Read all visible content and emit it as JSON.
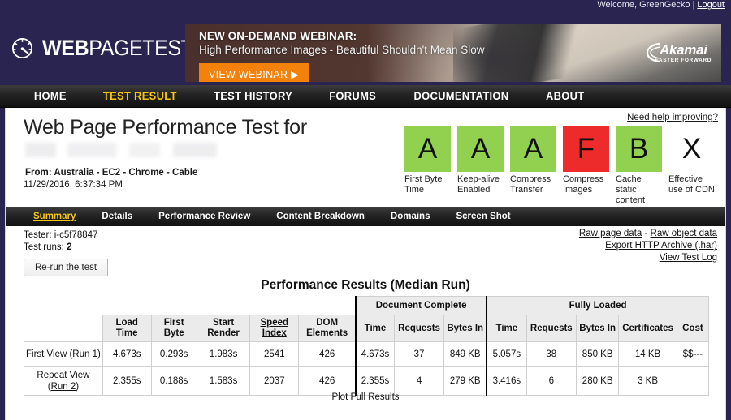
{
  "account": {
    "welcome_text": "Welcome, GreenGecko",
    "separator": "|",
    "logout_label": "Logout"
  },
  "brand": {
    "logo_bold": "WEB",
    "logo_regular": "PAGETEST",
    "logo_icon": "speedometer-icon"
  },
  "banner": {
    "headline": "NEW ON-DEMAND WEBINAR:",
    "subhead": "High Performance Images  -  Beautiful Shouldn't Mean Slow",
    "cta_label": "VIEW WEBINAR ▶",
    "sponsor_name": "Akamai",
    "sponsor_tagline": "FASTER FORWARD"
  },
  "mainnav": {
    "items": [
      {
        "label": "HOME",
        "active": false
      },
      {
        "label": "TEST RESULT",
        "active": true
      },
      {
        "label": "TEST HISTORY",
        "active": false
      },
      {
        "label": "FORUMS",
        "active": false
      },
      {
        "label": "DOCUMENTATION",
        "active": false
      },
      {
        "label": "ABOUT",
        "active": false
      }
    ]
  },
  "test": {
    "page_title": "Web Page Performance Test for",
    "url_redacted": true,
    "from_line": "From: Australia - EC2 - Chrome - Cable",
    "date_line": "11/29/2016, 6:37:34 PM",
    "tester_label": "Tester: i-c5f78847",
    "test_runs_label": "Test runs:",
    "test_runs_value": "2",
    "rerun_label": "Re-run the test"
  },
  "grades": {
    "need_help_label": "Need help improving?",
    "items": [
      {
        "grade": "A",
        "label": "First Byte Time",
        "color": "#92d050",
        "style": "green"
      },
      {
        "grade": "A",
        "label": "Keep-alive Enabled",
        "color": "#92d050",
        "style": "green"
      },
      {
        "grade": "A",
        "label": "Compress Transfer",
        "color": "#92d050",
        "style": "green"
      },
      {
        "grade": "F",
        "label": "Compress Images",
        "color": "#ee2b2b",
        "style": "red"
      },
      {
        "grade": "B",
        "label": "Cache static content",
        "color": "#92d050",
        "style": "green"
      },
      {
        "grade": "X",
        "label": "Effective use of CDN",
        "color": "#ffffff",
        "style": "none"
      }
    ]
  },
  "tabs": {
    "items": [
      {
        "label": "Summary",
        "active": true
      },
      {
        "label": "Details",
        "active": false
      },
      {
        "label": "Performance Review",
        "active": false
      },
      {
        "label": "Content Breakdown",
        "active": false
      },
      {
        "label": "Domains",
        "active": false
      },
      {
        "label": "Screen Shot",
        "active": false
      }
    ]
  },
  "rightlinks": {
    "raw_page_data": "Raw page data",
    "dash": " - ",
    "raw_object_data": "Raw object data",
    "export_har": "Export HTTP Archive (.har)",
    "view_test_log": "View Test Log"
  },
  "results": {
    "title": "Performance Results (Median Run)",
    "group_doc_complete": "Document Complete",
    "group_fully_loaded": "Fully Loaded",
    "columns": {
      "load_time": "Load Time",
      "first_byte": "First Byte",
      "start_render": "Start Render",
      "speed_index": "Speed Index",
      "dom_elements": "DOM Elements",
      "dc_time": "Time",
      "dc_requests": "Requests",
      "dc_bytes_in": "Bytes In",
      "fl_time": "Time",
      "fl_requests": "Requests",
      "fl_bytes_in": "Bytes In",
      "certificates": "Certificates",
      "cost": "Cost"
    },
    "rows": [
      {
        "view_label": "First View (",
        "run_link": "Run 1",
        "view_label_end": ")",
        "load_time": "4.673s",
        "first_byte": "0.293s",
        "start_render": "1.983s",
        "speed_index": "2541",
        "dom_elements": "426",
        "dc_time": "4.673s",
        "dc_requests": "37",
        "dc_bytes_in": "849 KB",
        "fl_time": "5.057s",
        "fl_requests": "38",
        "fl_bytes_in": "850 KB",
        "certificates": "14 KB",
        "cost": "$$---"
      },
      {
        "view_label": "Repeat View",
        "run_link": "Run 2",
        "view_label_end": "",
        "load_time": "2.355s",
        "first_byte": "0.188s",
        "start_render": "1.583s",
        "speed_index": "2037",
        "dom_elements": "426",
        "dc_time": "2.355s",
        "dc_requests": "4",
        "dc_bytes_in": "279 KB",
        "fl_time": "3.416s",
        "fl_requests": "6",
        "fl_bytes_in": "280 KB",
        "certificates": "3 KB",
        "cost": ""
      }
    ],
    "plot_full_results": "Plot Full Results"
  }
}
